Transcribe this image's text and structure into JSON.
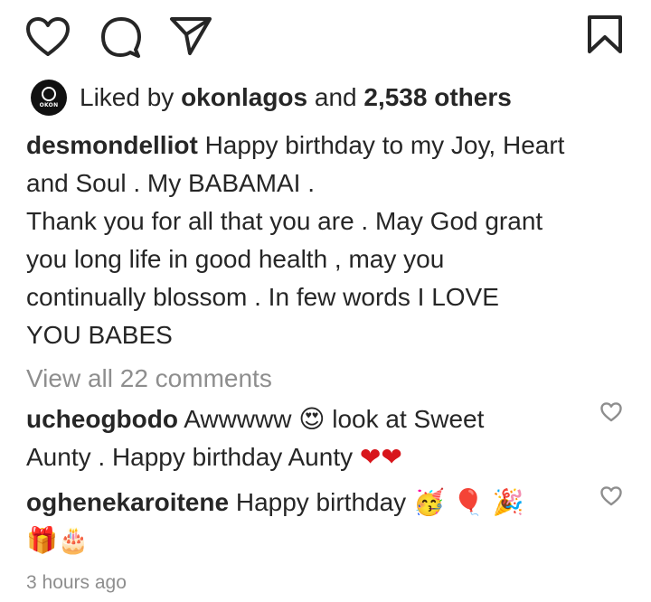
{
  "action_bar": {
    "like_icon": "heart-outline-icon",
    "comment_icon": "comment-bubble-icon",
    "share_icon": "paper-plane-icon",
    "save_icon": "bookmark-icon"
  },
  "likes": {
    "avatar_label": "OKON",
    "prefix": "Liked by",
    "user": "okonlagos",
    "connector": "and",
    "others": "2,538 others"
  },
  "caption": {
    "username": "desmondelliot",
    "line1": "Happy birthday to my Joy, Heart",
    "line2": "and Soul . My BABAMAI .",
    "line3": "Thank you for all that you are . May God grant",
    "line4": "you long life in good health , may you",
    "line5": "continually blossom . In few words I LOVE",
    "line6": "YOU BABES"
  },
  "view_all_comments": "View all 22 comments",
  "comments": [
    {
      "username": "ucheogbodo",
      "text_a": "Awwwww",
      "emoji_a": "😍",
      "text_b": "look at Sweet",
      "line2": "Aunty . Happy birthday Aunty",
      "emoji_b": "❤❤"
    },
    {
      "username": "oghenekaroitene",
      "text": "Happy birthday",
      "emoji_a": "🥳 🎈 🎉",
      "emoji_b": "🎁🎂"
    }
  ],
  "timestamp": "3 hours ago",
  "colors": {
    "text": "#262626",
    "muted": "#8e8e8e",
    "heart_red": "#d8151b"
  }
}
